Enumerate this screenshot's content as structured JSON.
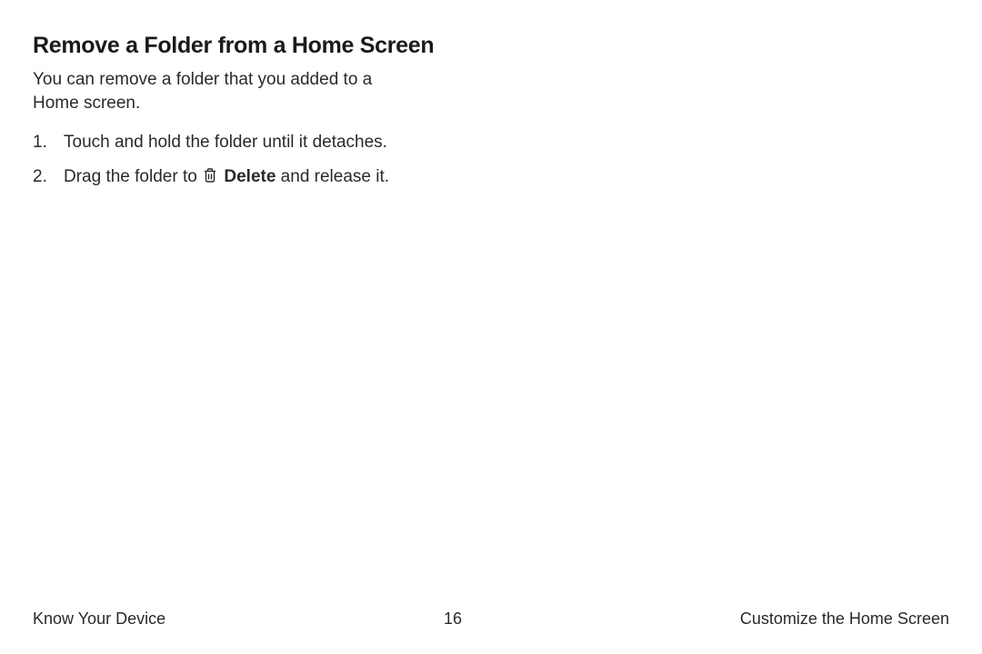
{
  "heading": "Remove a Folder from a Home Screen",
  "intro": "You can remove a folder that you added to a Home screen.",
  "steps": {
    "s1_num": "1.",
    "s1_text": "Touch and hold the folder until it detaches.",
    "s2_num": "2.",
    "s2_prefix": "Drag the folder to ",
    "s2_bold": "Delete",
    "s2_suffix": " and release it."
  },
  "footer": {
    "left": "Know Your Device",
    "page": "16",
    "right": "Customize the Home Screen"
  }
}
